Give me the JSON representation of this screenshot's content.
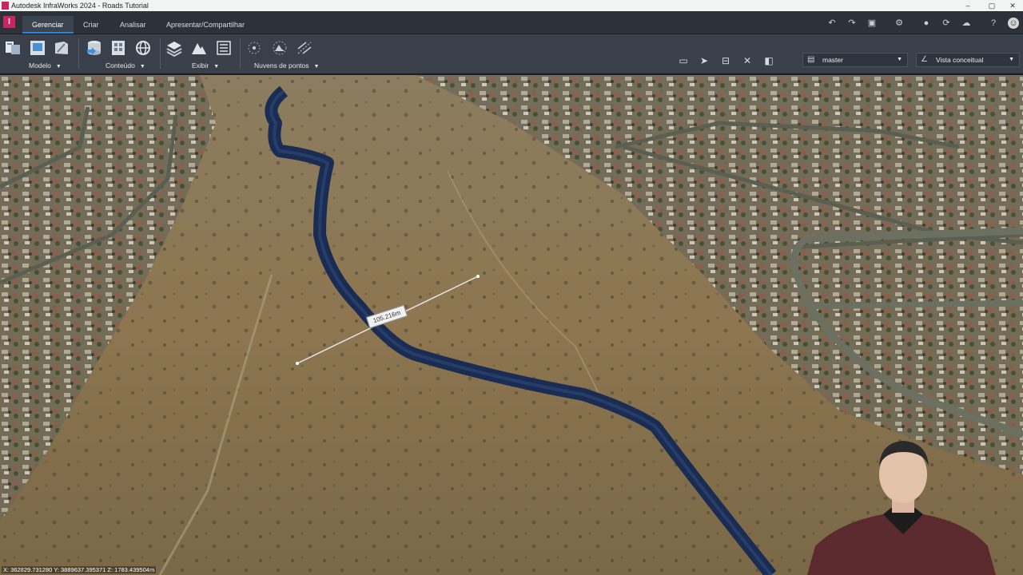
{
  "window": {
    "title": "Autodesk InfraWorks 2024 - Roads Tutorial",
    "controls": [
      "–",
      "▢",
      "✕"
    ]
  },
  "tabs": [
    {
      "label": "Gerenciar",
      "active": true
    },
    {
      "label": "Criar",
      "active": false
    },
    {
      "label": "Analisar",
      "active": false
    },
    {
      "label": "Apresentar/Compartilhar",
      "active": false
    }
  ],
  "ribbon_groups": {
    "modelo": "Modelo",
    "conteudo": "Conteúdo",
    "exibir": "Exibir",
    "nuvens": "Nuvens de pontos"
  },
  "dropdowns": {
    "proposal": "master",
    "style": "Vista conceitual"
  },
  "viewport": {
    "measurement_label": "105.216m",
    "coordinates": "X: 362829.731280 Y: 3889637.395371 Z: 1783.439504m"
  },
  "colors": {
    "accent": "#2b82d6",
    "brand": "#c8265f",
    "road": "#1d2f55",
    "terrain": "#8f7a55"
  }
}
